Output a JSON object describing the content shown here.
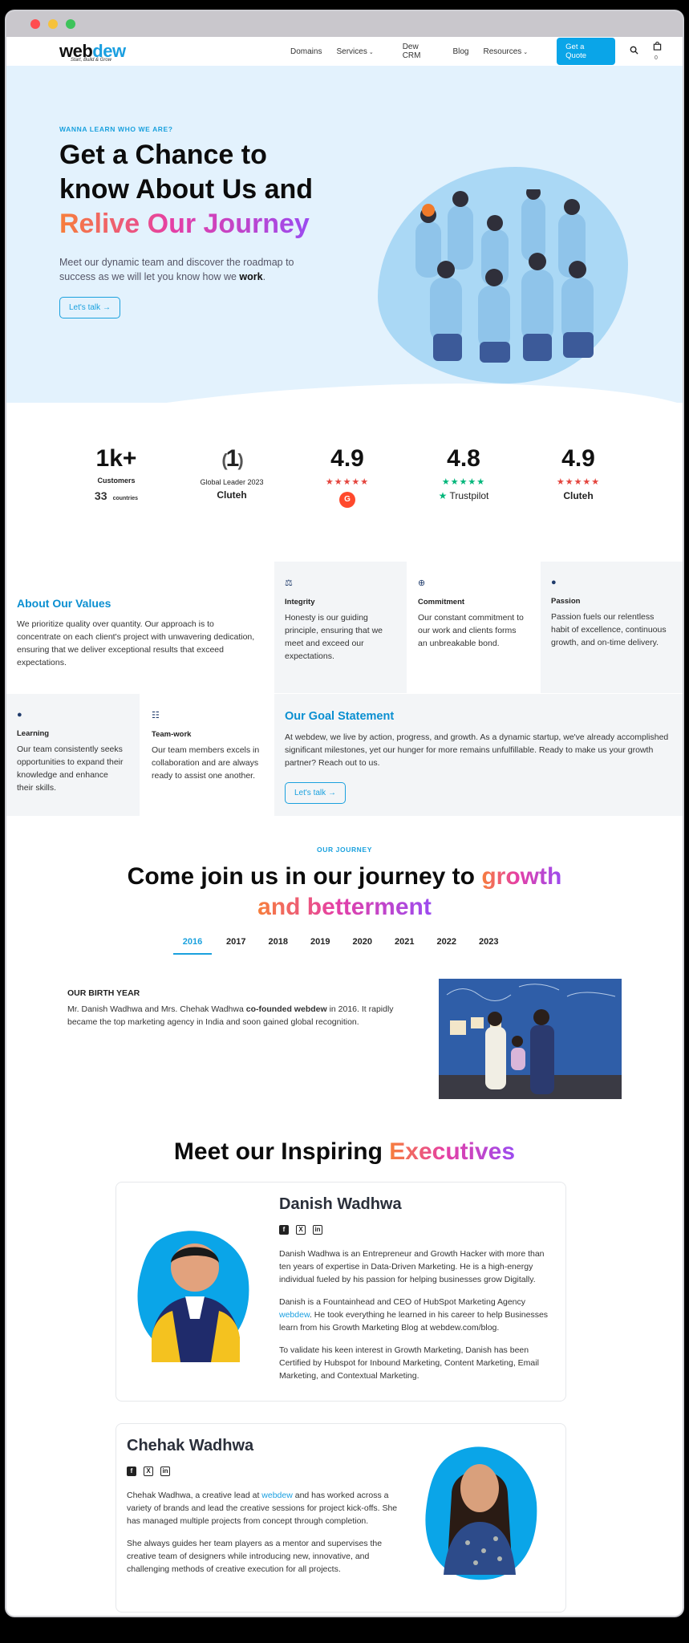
{
  "nav": {
    "logo_prefix": "web",
    "logo_accent": "dew",
    "logo_tagline": "Start, Build & Grow",
    "links": [
      "Domains",
      "Services",
      "Dew CRM",
      "Blog",
      "Resources"
    ],
    "quote_label": "Get a Quote",
    "cart_count": "0"
  },
  "hero": {
    "kicker": "WANNA LEARN WHO WE ARE?",
    "title_line1": "Get a Chance to",
    "title_line2": "know About Us and",
    "title_line3": "Relive Our Journey",
    "subtitle_pre": "Meet our dynamic team and discover the roadmap to success as we will let you know how we ",
    "subtitle_bold": "work",
    "subtitle_post": ".",
    "cta_label": "Let's talk"
  },
  "stats": {
    "customers_value": "1k+",
    "customers_label": "Customers",
    "countries_value": "33",
    "countries_label": "countries",
    "leader_value": "1",
    "leader_label": "Global Leader 2023",
    "leader_brand": "Cluteh",
    "g2_value": "4.9",
    "g2_brand": "G",
    "trustpilot_value": "4.8",
    "trustpilot_brand": "Trustpilot",
    "clutch_value": "4.9",
    "clutch_brand": "Cluteh",
    "stars": "★★★★★"
  },
  "values": {
    "about_title": "About Our Values",
    "about_text": "We prioritize quality over quantity. Our approach is to concentrate on each client's project with unwavering dedication, ensuring that we deliver exceptional results that exceed expectations.",
    "items": [
      {
        "title": "Integrity",
        "text": "Honesty is our guiding principle, ensuring that we meet and exceed our expectations."
      },
      {
        "title": "Commitment",
        "text": "Our constant commitment to our work and clients forms an unbreakable bond."
      },
      {
        "title": "Passion",
        "text": "Passion fuels our relentless habit of excellence, continuous growth, and on-time delivery."
      },
      {
        "title": "Learning",
        "text": "Our team consistently seeks opportunities to expand their knowledge and enhance their skills."
      },
      {
        "title": "Team-work",
        "text": "Our team members excels in collaboration and are always ready to assist one another."
      }
    ],
    "goal_title": "Our Goal Statement",
    "goal_text": "At webdew, we live by action, progress, and growth. As a dynamic startup, we've already accomplished significant milestones, yet our hunger for more remains unfulfillable. Ready to make us your growth partner? Reach out to us.",
    "goal_cta": "Let's talk"
  },
  "journey": {
    "kicker": "OUR JOURNEY",
    "title_pre": "Come join us in our journey to ",
    "title_grad1": "growth",
    "title_grad2": "and betterment",
    "years": [
      "2016",
      "2017",
      "2018",
      "2019",
      "2020",
      "2021",
      "2022",
      "2023"
    ],
    "active_year": "2016",
    "section_title": "OUR BIRTH YEAR",
    "text_pre": "Mr. Danish Wadhwa and Mrs. Chehak Wadhwa ",
    "text_bold": "co-founded webdew",
    "text_post": " in 2016. It rapidly became the top marketing agency in India and soon gained global recognition."
  },
  "executives": {
    "title_pre": "Meet our Inspiring ",
    "title_grad": "Executives",
    "danish": {
      "name": "Danish Wadhwa",
      "p1": "Danish Wadhwa is an Entrepreneur and Growth Hacker with more than ten years of expertise in Data-Driven Marketing. He is a high-energy individual fueled by his passion for helping businesses grow Digitally.",
      "p2_pre": "Danish is a Fountainhead and CEO of HubSpot Marketing Agency ",
      "p2_link": "webdew",
      "p2_post": ". He took everything he learned in his career to help Businesses learn from his Growth Marketing Blog at webdew.com/blog.",
      "p3": "To validate his keen interest in Growth Marketing, Danish has been Certified by Hubspot for Inbound Marketing, Content Marketing, Email Marketing, and Contextual Marketing."
    },
    "chehak": {
      "name": "Chehak Wadhwa",
      "p1_pre": "Chehak Wadhwa, a creative lead at ",
      "p1_link": "webdew",
      "p1_post": " and has worked across a variety of brands and lead the creative sessions for project kick-offs. She has managed multiple projects from concept through completion.",
      "p2": "She always guides her team players as a mentor and supervises the creative team of designers while introducing new, innovative, and challenging methods of creative execution for all projects."
    }
  }
}
